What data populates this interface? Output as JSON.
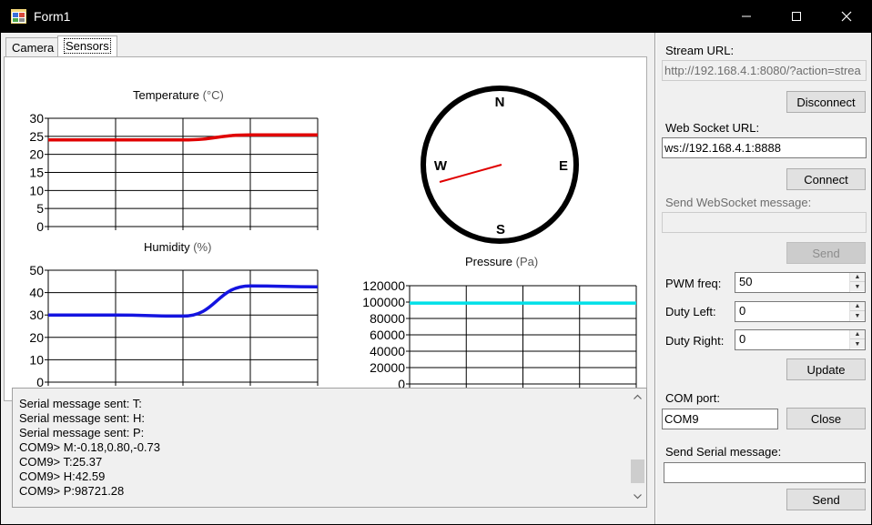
{
  "window": {
    "title": "Form1",
    "minimize_glyph": "—",
    "maximize_glyph": "☐",
    "close_glyph": "✕"
  },
  "tabs": [
    {
      "label": "Camera",
      "active": false
    },
    {
      "label": "Sensors",
      "active": true
    }
  ],
  "charts": {
    "temperature": {
      "title": "Temperature",
      "unit": "(°C)"
    },
    "humidity": {
      "title": "Humidity",
      "unit": "(%)"
    },
    "pressure": {
      "title": "Pressure",
      "unit": "(Pa)"
    }
  },
  "compass": {
    "north": "N",
    "east": "E",
    "south": "S",
    "west": "W",
    "needle_color": "#e00000",
    "heading_components": {
      "x": -0.18,
      "y": 0.8,
      "z": -0.73
    }
  },
  "chart_data": [
    {
      "type": "line",
      "title": "Temperature (°C)",
      "x": [
        0,
        1,
        2,
        3,
        4
      ],
      "series": [
        {
          "color": "#e00000",
          "values": [
            24,
            24,
            24,
            25.4,
            25.4
          ]
        }
      ],
      "ylim": [
        0,
        30
      ],
      "yticks": [
        0,
        5,
        10,
        15,
        20,
        25,
        30
      ],
      "grid": true
    },
    {
      "type": "line",
      "title": "Humidity (%)",
      "x": [
        0,
        1,
        2,
        3,
        4
      ],
      "series": [
        {
          "color": "#1414e0",
          "values": [
            30,
            30,
            29.5,
            43,
            42.6
          ]
        }
      ],
      "ylim": [
        0,
        50
      ],
      "yticks": [
        0,
        10,
        20,
        30,
        40,
        50
      ],
      "grid": true
    },
    {
      "type": "line",
      "title": "Pressure (Pa)",
      "x": [
        0,
        1,
        2,
        3,
        4
      ],
      "series": [
        {
          "color": "#00e0e8",
          "values": [
            98721,
            98721,
            98721,
            98721,
            98721
          ]
        }
      ],
      "ylim": [
        0,
        120000
      ],
      "yticks": [
        0,
        20000,
        40000,
        60000,
        80000,
        100000,
        120000
      ],
      "grid": true
    }
  ],
  "log": {
    "lines": [
      "Serial message sent: T:",
      "Serial message sent: H:",
      "Serial message sent: P:",
      "COM9> M:-0.18,0.80,-0.73",
      "COM9> T:25.37",
      "COM9> H:42.59",
      "COM9> P:98721.28"
    ]
  },
  "side": {
    "stream_url_label": "Stream URL:",
    "stream_url_value": "http://192.168.4.1:8080/?action=strea",
    "disconnect_label": "Disconnect",
    "ws_url_label": "Web Socket URL:",
    "ws_url_value": "ws://192.168.4.1:8888",
    "connect_label": "Connect",
    "ws_msg_label": "Send WebSocket message:",
    "ws_msg_value": "",
    "ws_send_label": "Send",
    "pwm_label": "PWM freq:",
    "pwm_value": "50",
    "duty_left_label": "Duty Left:",
    "duty_left_value": "0",
    "duty_right_label": "Duty Right:",
    "duty_right_value": "0",
    "update_label": "Update",
    "com_port_label": "COM port:",
    "com_port_value": "COM9",
    "close_label": "Close",
    "serial_msg_label": "Send Serial message:",
    "serial_msg_value": "",
    "serial_send_label": "Send"
  }
}
